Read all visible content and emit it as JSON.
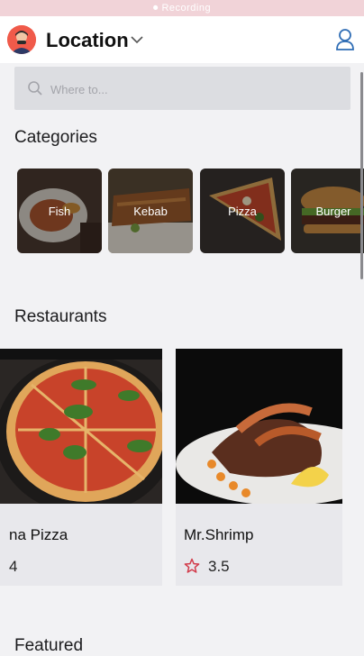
{
  "status_bar": {
    "text": "⏺ Recording"
  },
  "header": {
    "title": "Location"
  },
  "search": {
    "placeholder": "Where to..."
  },
  "categories": {
    "title": "Categories",
    "items": [
      {
        "label": "Fish"
      },
      {
        "label": "Kebab"
      },
      {
        "label": "Pizza"
      },
      {
        "label": "Burger"
      }
    ]
  },
  "restaurants": {
    "title": "Restaurants",
    "items": [
      {
        "name": "na Pizza",
        "rating": "4"
      },
      {
        "name": "Mr.Shrimp",
        "rating": "3.5"
      }
    ]
  },
  "featured": {
    "title": "Featured"
  },
  "colors": {
    "accent": "#d23c4b",
    "avatar_bg": "#f05a4a",
    "user_icon": "#2f6db5"
  }
}
